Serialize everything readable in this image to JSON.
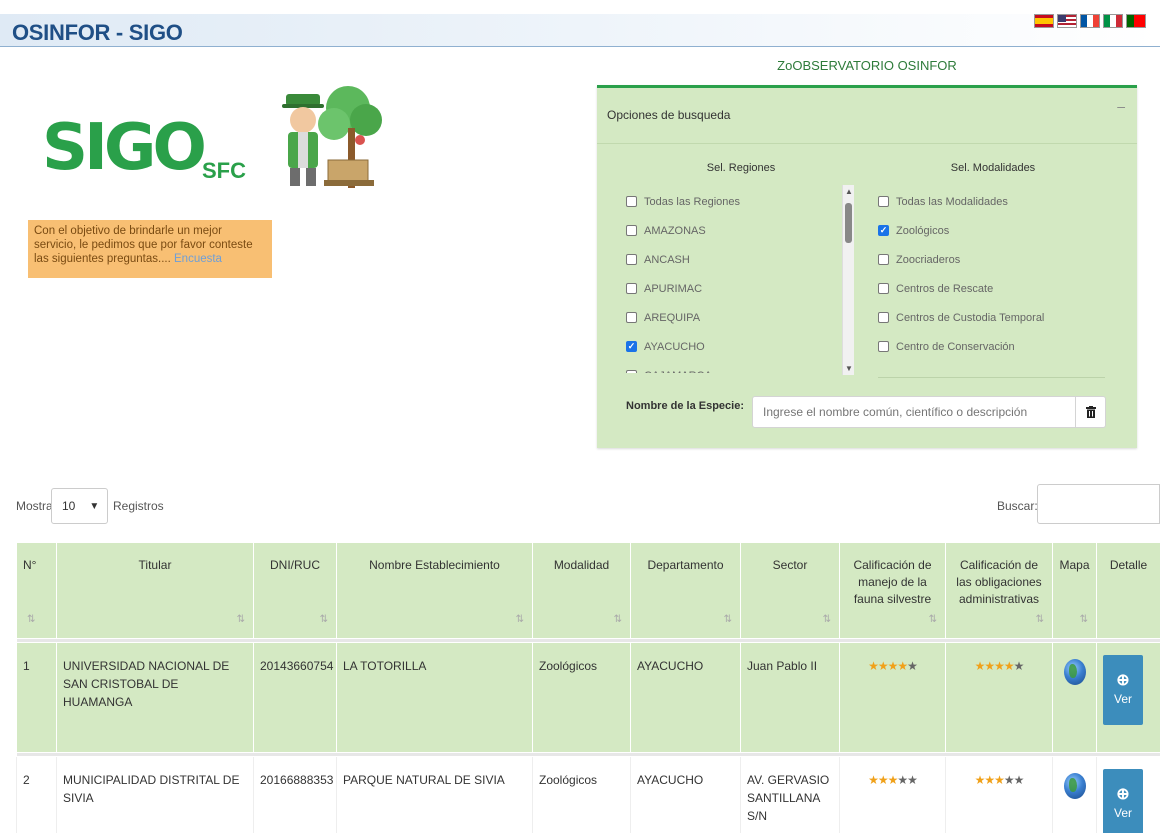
{
  "header": {
    "title": "OSINFOR - SIGO",
    "flags": [
      "es-flag-icon",
      "us-flag-icon",
      "fr-flag-icon",
      "it-flag-icon",
      "pt-flag-icon"
    ]
  },
  "logo": {
    "main": "SIGO",
    "sub": "SFC"
  },
  "notice": {
    "text": "Con el objetivo de brindarle un mejor servicio, le pedimos que por favor conteste las siguientes preguntas.... ",
    "link": "Encuesta"
  },
  "observatory": {
    "title": "ZoOBSERVATORIO OSINFOR",
    "panel_title": "Opciones de busqueda",
    "collapse": "–",
    "regions_title": "Sel. Regiones",
    "modalities_title": "Sel. Modalidades",
    "regions": [
      {
        "label": "Todas las Regiones",
        "checked": false
      },
      {
        "label": "AMAZONAS",
        "checked": false
      },
      {
        "label": "ANCASH",
        "checked": false
      },
      {
        "label": "APURIMAC",
        "checked": false
      },
      {
        "label": "AREQUIPA",
        "checked": false
      },
      {
        "label": "AYACUCHO",
        "checked": true
      },
      {
        "label": "CAJAMARCA",
        "checked": false
      }
    ],
    "modalities": [
      {
        "label": "Todas las Modalidades",
        "checked": false
      },
      {
        "label": "Zoológicos",
        "checked": true
      },
      {
        "label": "Zoocriaderos",
        "checked": false
      },
      {
        "label": "Centros de Rescate",
        "checked": false
      },
      {
        "label": "Centros de Custodia Temporal",
        "checked": false
      },
      {
        "label": "Centro de Conservación",
        "checked": false
      }
    ],
    "species_label": "Nombre de la Especie:",
    "species_placeholder": "Ingrese el nombre común, científico o descripción"
  },
  "table_controls": {
    "show_label": "Mostrar",
    "show_value": "10",
    "records_label": "Registros",
    "search_label": "Buscar:"
  },
  "table": {
    "headers": [
      "N°",
      "Titular",
      "DNI/RUC",
      "Nombre Establecimiento",
      "Modalidad",
      "Departamento",
      "Sector",
      "Calificación de manejo de la fauna silvestre",
      "Calificación de las obligaciones administrativas",
      "Mapa",
      "Detalle"
    ],
    "rows": [
      {
        "n": "1",
        "titular": "UNIVERSIDAD NACIONAL DE SAN CRISTOBAL DE HUAMANGA",
        "dni": "20143660754",
        "establecimiento": "LA TOTORILLA",
        "modalidad": "Zoológicos",
        "departamento": "AYACUCHO",
        "sector": "Juan Pablo II",
        "rating_fauna": 4,
        "rating_admin": 4,
        "detalle": "Ver"
      },
      {
        "n": "2",
        "titular": "MUNICIPALIDAD DISTRITAL DE SIVIA",
        "dni": "20166888353",
        "establecimiento": "PARQUE NATURAL DE SIVIA",
        "modalidad": "Zoológicos",
        "departamento": "AYACUCHO",
        "sector": "AV. GERVASIO SANTILLANA S/N",
        "rating_fauna": 3,
        "rating_admin": 3,
        "detalle": "Ver"
      }
    ]
  },
  "colors": {
    "brand_green": "#2aa04a",
    "panel_green": "#d4e9c3",
    "title_blue": "#1f4f86",
    "button_blue": "#3c8dbc"
  }
}
